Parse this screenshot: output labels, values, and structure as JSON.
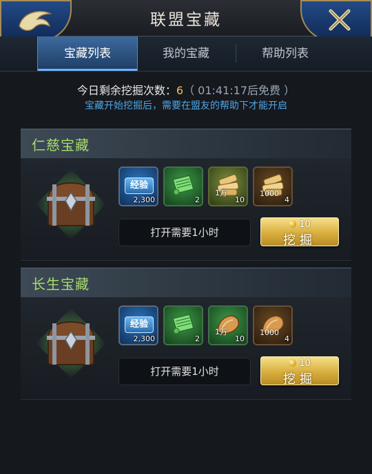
{
  "header": {
    "title": "联盟宝藏"
  },
  "tabs": [
    {
      "label": "宝藏列表",
      "active": true
    },
    {
      "label": "我的宝藏",
      "active": false
    },
    {
      "label": "帮助列表",
      "active": false
    }
  ],
  "info": {
    "remaining_label": "今日剩余挖掘次数：",
    "remaining_count": "6",
    "free_timer": "（ 01:41:17后免费 ）",
    "hint": "宝藏开始挖掘后，需要在盟友的帮助下才能开启"
  },
  "treasures": [
    {
      "name": "仁慈宝藏",
      "rewards": [
        {
          "icon": "experience-icon",
          "mark": "经验",
          "count": "2,300"
        },
        {
          "icon": "scroll-icon",
          "mark": "",
          "count": "2"
        },
        {
          "icon": "wood-icon",
          "mark": "1万",
          "count": "10"
        },
        {
          "icon": "wood-icon",
          "mark": "1000",
          "count": "4"
        }
      ],
      "open_time": "打开需要1小时",
      "cost": "10",
      "dig_label": "挖掘"
    },
    {
      "name": "长生宝藏",
      "rewards": [
        {
          "icon": "experience-icon",
          "mark": "经验",
          "count": "2,300"
        },
        {
          "icon": "scroll-icon",
          "mark": "",
          "count": "2"
        },
        {
          "icon": "food-icon",
          "mark": "1万",
          "count": "10"
        },
        {
          "icon": "food-icon",
          "mark": "1000",
          "count": "4"
        }
      ],
      "open_time": "打开需要1小时",
      "cost": "10",
      "dig_label": "挖掘"
    }
  ]
}
